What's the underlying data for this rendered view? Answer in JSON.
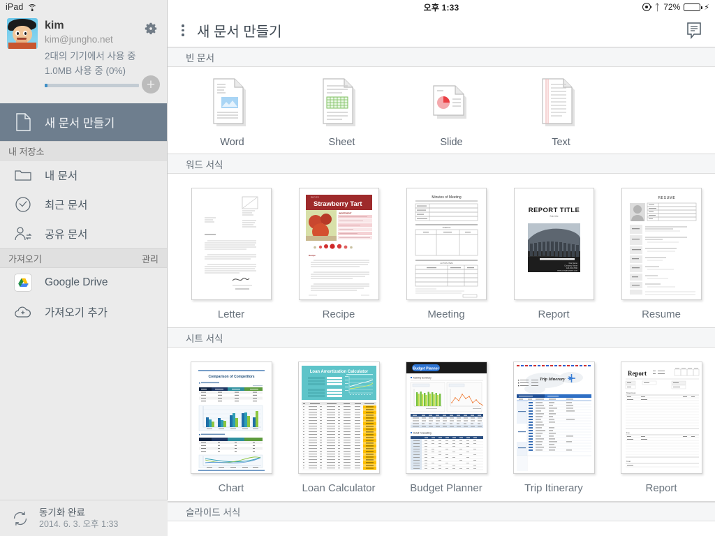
{
  "status_bar": {
    "device": "iPad",
    "wifi_icon": "wifi-icon",
    "time": "오후 1:33",
    "rotation_lock_icon": "rotation-lock-icon",
    "bluetooth_icon": "bluetooth-icon",
    "battery_percent": "72%",
    "battery_icon": "battery-icon",
    "charging_icon": "charging-bolt-icon"
  },
  "sidebar": {
    "account": {
      "avatar_icon": "user-avatar",
      "name": "kim",
      "email": "kim@jungho.net",
      "devices_line": "2대의 기기에서 사용 중",
      "storage_line": "1.0MB 사용 중 (0%)",
      "storage_percent": 1,
      "settings_icon": "gear-icon",
      "add_icon": "plus-icon"
    },
    "selected_item": {
      "label": "새 문서 만들기",
      "icon": "new-document-icon"
    },
    "groups": [
      {
        "title": "내 저장소",
        "action": "",
        "items": [
          {
            "label": "내 문서",
            "icon": "folder-icon"
          },
          {
            "label": "최근 문서",
            "icon": "clock-check-icon"
          },
          {
            "label": "공유 문서",
            "icon": "shared-user-icon"
          }
        ]
      },
      {
        "title": "가져오기",
        "action": "관리",
        "items": [
          {
            "label": "Google Drive",
            "icon": "google-drive-icon"
          },
          {
            "label": "가져오기 추가",
            "icon": "add-cloud-icon"
          }
        ]
      }
    ],
    "sync": {
      "icon": "sync-icon",
      "status": "동기화 완료",
      "timestamp": "2014. 6. 3. 오후 1:33"
    }
  },
  "header": {
    "menu_icon": "kebab-menu-icon",
    "title": "새 문서 만들기",
    "feedback_icon": "comment-bubble-icon"
  },
  "sections": [
    {
      "id": "blank",
      "title": "빈 문서",
      "items": [
        {
          "label": "Word",
          "icon": "word-doc-icon"
        },
        {
          "label": "Sheet",
          "icon": "sheet-doc-icon"
        },
        {
          "label": "Slide",
          "icon": "slide-doc-icon"
        },
        {
          "label": "Text",
          "icon": "text-doc-icon"
        }
      ]
    },
    {
      "id": "word-templates",
      "title": "워드 서식",
      "items": [
        {
          "label": "Letter",
          "thumb": "letter-thumb"
        },
        {
          "label": "Recipe",
          "thumb": "recipe-thumb",
          "heading": "Strawberry Tart"
        },
        {
          "label": "Meeting",
          "thumb": "meeting-thumb",
          "heading": "Minutes of Meeting"
        },
        {
          "label": "Report",
          "thumb": "report-thumb",
          "heading": "REPORT TITLE"
        },
        {
          "label": "Resume",
          "thumb": "resume-thumb",
          "heading": "RESUME"
        }
      ]
    },
    {
      "id": "sheet-templates",
      "title": "시트 서식",
      "items": [
        {
          "label": "Chart",
          "thumb": "chart-thumb",
          "heading": "Comparison of Competitors"
        },
        {
          "label": "Loan Calculator",
          "thumb": "loan-thumb",
          "heading": "Loan Amortization Calculator"
        },
        {
          "label": "Budget Planner",
          "thumb": "budget-thumb",
          "heading": "Budget Planner"
        },
        {
          "label": "Trip Itinerary",
          "thumb": "trip-thumb",
          "heading": "Trip Itinerary"
        },
        {
          "label": "Report",
          "thumb": "sheet-report-thumb",
          "heading": "Report"
        }
      ]
    },
    {
      "id": "slide-templates",
      "title": "슬라이드 서식",
      "items": []
    }
  ],
  "colors": {
    "sidebar_bg": "#ebebeb",
    "selected_bg": "#6e7e8e",
    "section_header_bg": "#f5f6f7",
    "accent_blue": "#3e8fc6",
    "battery_green": "#4cd964"
  }
}
